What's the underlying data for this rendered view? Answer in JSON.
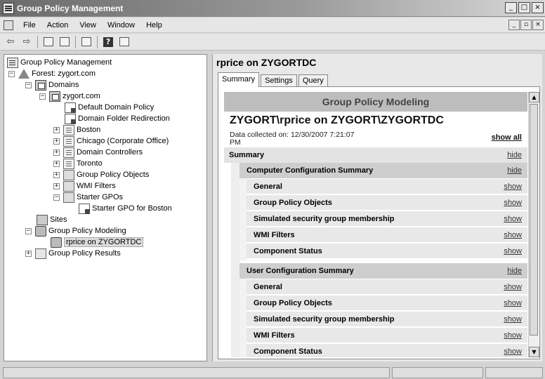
{
  "window": {
    "title": "Group Policy Management",
    "min": "_",
    "max": "□",
    "close": "×"
  },
  "menu": {
    "items": [
      "File",
      "Action",
      "View",
      "Window",
      "Help"
    ],
    "mdi": [
      "_",
      "▫",
      "×"
    ]
  },
  "toolbar": {
    "buttons": [
      "back-icon",
      "forward-icon",
      "up-icon",
      "show-hide-tree-icon",
      "refresh-icon",
      "help-icon",
      "properties-icon"
    ],
    "help_glyph": "?"
  },
  "tree": {
    "root": "Group Policy Management",
    "forest": "Forest: zygort.com",
    "domains": "Domains",
    "domain": "zygort.com",
    "ddp": "Default Domain Policy",
    "dfr": "Domain Folder Redirection",
    "boston": "Boston",
    "chicago": "Chicago (Corporate Office)",
    "dc": "Domain Controllers",
    "toronto": "Toronto",
    "gpo": "Group Policy Objects",
    "wmi": "WMI Filters",
    "starter": "Starter GPOs",
    "starter_boston": "Starter GPO for Boston",
    "sites": "Sites",
    "modeling": "Group Policy Modeling",
    "rprice": "rprice on ZYGORTDC",
    "results": "Group Policy Results"
  },
  "expanders": {
    "minus": "−",
    "plus": "+"
  },
  "details": {
    "title": "rprice on ZYGORTDC",
    "tabs": [
      "Summary",
      "Settings",
      "Query"
    ],
    "active_tab": "Summary"
  },
  "report": {
    "header": "Group Policy Modeling",
    "title": "ZYGORT\\rprice on ZYGORT\\ZYGORTDC",
    "collected_line1": "Data collected on: 12/30/2007 7:21:07",
    "collected_line2": "PM",
    "show_all": "show all",
    "summary": {
      "label": "Summary",
      "action": "hide"
    },
    "computer": {
      "label": "Computer Configuration Summary",
      "action": "hide",
      "items": [
        {
          "label": "General",
          "action": "show"
        },
        {
          "label": "Group Policy Objects",
          "action": "show"
        },
        {
          "label": "Simulated security group membership",
          "action": "show"
        },
        {
          "label": "WMI Filters",
          "action": "show"
        },
        {
          "label": "Component Status",
          "action": "show"
        }
      ]
    },
    "user": {
      "label": "User Configuration Summary",
      "action": "hide",
      "items": [
        {
          "label": "General",
          "action": "show"
        },
        {
          "label": "Group Policy Objects",
          "action": "show"
        },
        {
          "label": "Simulated security group membership",
          "action": "show"
        },
        {
          "label": "WMI Filters",
          "action": "show"
        },
        {
          "label": "Component Status",
          "action": "show"
        }
      ]
    }
  },
  "scroll": {
    "up": "▲",
    "down": "▼"
  },
  "colors": {
    "header_bar": "#bdbdbd",
    "section_bar": "#cecece",
    "item_bar": "#e8e8e8"
  }
}
